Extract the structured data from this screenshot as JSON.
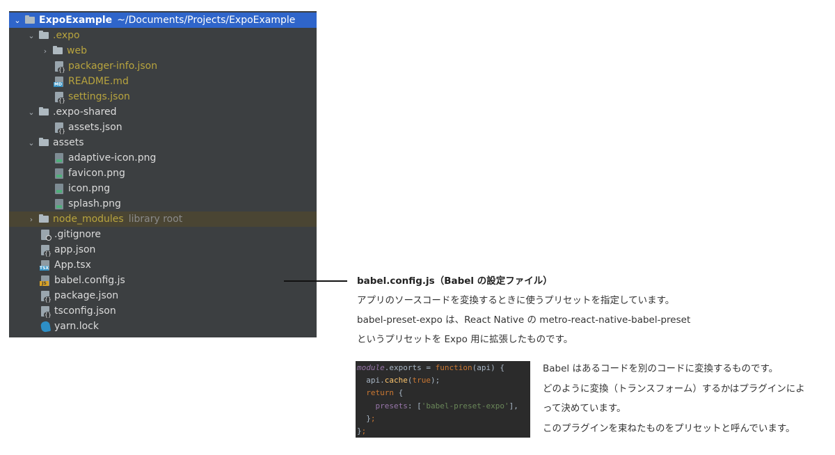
{
  "tree": {
    "root": {
      "name": "ExpoExample",
      "path": "~/Documents/Projects/ExpoExample"
    },
    "expo_folder": {
      "name": ".expo",
      "web": "web",
      "files": [
        "packager-info.json",
        "README.md",
        "settings.json"
      ]
    },
    "expo_shared": {
      "name": ".expo-shared",
      "files": [
        "assets.json"
      ]
    },
    "assets": {
      "name": "assets",
      "files": [
        "adaptive-icon.png",
        "favicon.png",
        "icon.png",
        "splash.png"
      ]
    },
    "node_modules": {
      "name": "node_modules",
      "tag": "library root"
    },
    "root_files": [
      ".gitignore",
      "app.json",
      "App.tsx",
      "babel.config.js",
      "package.json",
      "tsconfig.json",
      "yarn.lock"
    ],
    "icon_tags": {
      "md": "MD",
      "tsx": "TSX",
      "js": "JS"
    },
    "arrows": {
      "expanded": "⌄",
      "collapsed": "›"
    }
  },
  "explanation": {
    "heading": "babel.config.js（Babel の設定ファイル）",
    "lines": [
      "アプリのソースコードを変換するときに使うプリセットを指定しています。",
      "babel-preset-expo は、React Native の metro-react-native-babel-preset",
      "というプリセットを Expo 用に拡張したものです。"
    ]
  },
  "code": {
    "l1": {
      "module": "module",
      "dot_exports": ".exports = ",
      "function_kw": "function",
      "args": "(api) {"
    },
    "l2": {
      "obj": "  api.",
      "method": "cache",
      "open": "(",
      "value": "true",
      "close": ");"
    },
    "l3": {
      "indent": "  ",
      "return_kw": "return",
      "rest": " {"
    },
    "l4": {
      "indent": "    ",
      "prop": "presets",
      "colon": ": [",
      "str": "'babel-preset-expo'",
      "close": "],"
    },
    "l5": {
      "indent": "  ",
      "close": "}",
      "semi": ";"
    },
    "l6": {
      "close": "}",
      "semi": ";"
    }
  },
  "note": {
    "lines": [
      "Babel はあるコードを別のコードに変換するものです。",
      "どのように変換（トランスフォーム）するかはプラグインによ",
      "って決めています。",
      "このプラグインを束ねたものをプリセットと呼んでいます。"
    ]
  },
  "colors": {
    "panel_bg": "#3c3f41",
    "selection": "#2f65ca",
    "ignored_yellow": "#b8a43e",
    "code_bg": "#2b2b2b"
  }
}
